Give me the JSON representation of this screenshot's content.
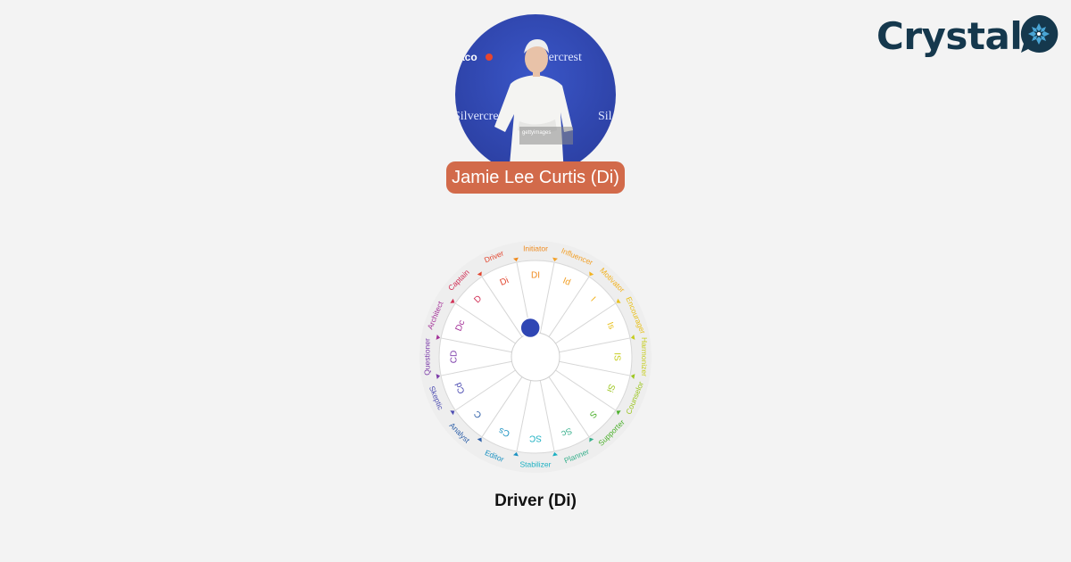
{
  "brand": {
    "name": "Crystal",
    "color": "#15384d",
    "mark_icon": "crystal-snowflake-icon",
    "mark_accent": "#4aa6d6"
  },
  "profile": {
    "name_label": "Jamie Lee Curtis (Di)",
    "badge_color": "#d26a4a",
    "photo_watermark": "gettyimages"
  },
  "disc_wheel": {
    "current_type": "Di",
    "segments": [
      {
        "code": "DI",
        "role": "Initiator",
        "color": "#ef8a1e"
      },
      {
        "code": "Id",
        "role": "Influencer",
        "color": "#f2a12a"
      },
      {
        "code": "I",
        "role": "Motivator",
        "color": "#f2b21f"
      },
      {
        "code": "Is",
        "role": "Encourager",
        "color": "#e8c01c"
      },
      {
        "code": "IS",
        "role": "Harmonizer",
        "color": "#c6cd1e"
      },
      {
        "code": "Si",
        "role": "Counselor",
        "color": "#9cc61f"
      },
      {
        "code": "S",
        "role": "Supporter",
        "color": "#4cb12c"
      },
      {
        "code": "Sc",
        "role": "Planner",
        "color": "#38b08c"
      },
      {
        "code": "SC",
        "role": "Stabilizer",
        "color": "#1cb0c2"
      },
      {
        "code": "Cs",
        "role": "Editor",
        "color": "#1c92c2"
      },
      {
        "code": "C",
        "role": "Analyst",
        "color": "#2d5fa8"
      },
      {
        "code": "Cd",
        "role": "Skeptic",
        "color": "#4d4db2"
      },
      {
        "code": "CD",
        "role": "Questioner",
        "color": "#7a3aa8"
      },
      {
        "code": "Dc",
        "role": "Architect",
        "color": "#a33098"
      },
      {
        "code": "D",
        "role": "Captain",
        "color": "#d12f55"
      },
      {
        "code": "Di",
        "role": "Driver",
        "color": "#e2452e"
      }
    ]
  },
  "type_caption": "Driver (Di)"
}
